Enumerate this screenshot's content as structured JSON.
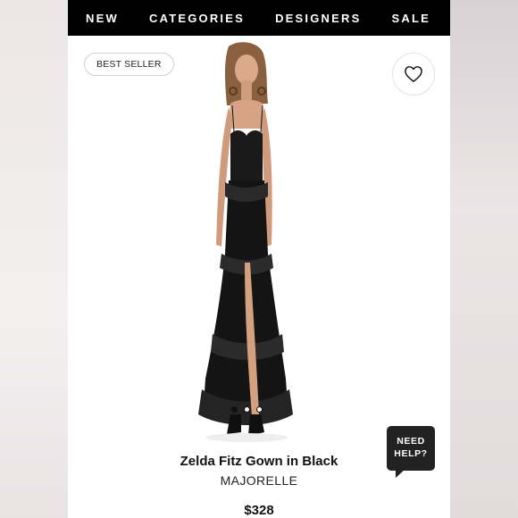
{
  "nav": {
    "items": [
      "NEW",
      "CATEGORIES",
      "DESIGNERS",
      "SALE"
    ]
  },
  "badge": "BEST SELLER",
  "icons": {
    "favorite": "heart-icon"
  },
  "carousel": {
    "count": 3,
    "active": 1
  },
  "help": {
    "line1": "NEED",
    "line2": "HELP?"
  },
  "product": {
    "title": "Zelda Fitz Gown in Black",
    "brand": "MAJORELLE",
    "price": "$328"
  },
  "colors": {
    "nav_bg": "#000000",
    "accent": "#222222"
  }
}
